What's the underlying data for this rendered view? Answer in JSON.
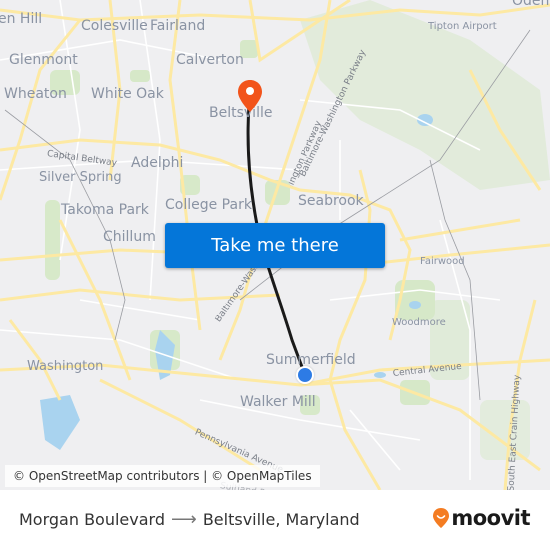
{
  "map": {
    "places": [
      {
        "id": "glen-hill",
        "label": "en Hill",
        "size": "l"
      },
      {
        "id": "colesville",
        "label": "Colesville",
        "size": "l"
      },
      {
        "id": "fairland",
        "label": "Fairland",
        "size": "l"
      },
      {
        "id": "glenmont",
        "label": "Glenmont",
        "size": "l"
      },
      {
        "id": "calverton",
        "label": "Calverton",
        "size": "l"
      },
      {
        "id": "wheaton",
        "label": "Wheaton",
        "size": "l"
      },
      {
        "id": "white-oak",
        "label": "White Oak",
        "size": "l"
      },
      {
        "id": "beltsville",
        "label": "Beltsville",
        "size": "l"
      },
      {
        "id": "adelphi",
        "label": "Adelphi",
        "size": "l"
      },
      {
        "id": "silver-spring",
        "label": "Silver Spring",
        "size": "m"
      },
      {
        "id": "takoma-park",
        "label": "Takoma Park",
        "size": "l"
      },
      {
        "id": "college-park",
        "label": "College Park",
        "size": "l"
      },
      {
        "id": "seabrook",
        "label": "Seabrook",
        "size": "l"
      },
      {
        "id": "chillum",
        "label": "Chillum",
        "size": "l"
      },
      {
        "id": "washington",
        "label": "Washington",
        "size": "m"
      },
      {
        "id": "summerfield",
        "label": "Summerfield",
        "size": "l"
      },
      {
        "id": "walker-mill",
        "label": "Walker Mill",
        "size": "l"
      },
      {
        "id": "woodmore",
        "label": "Woodmore",
        "size": "s"
      },
      {
        "id": "fairwood",
        "label": "Fairwood",
        "size": "s"
      },
      {
        "id": "tipton-airport",
        "label": "Tipton Airport",
        "size": "s"
      },
      {
        "id": "odenton",
        "label": "Oden",
        "size": "l"
      }
    ],
    "road_labels": [
      {
        "id": "capital-beltway",
        "label": "Capital Beltway"
      },
      {
        "id": "bw-parkway-north",
        "label": "Baltimore-Washington Parkway"
      },
      {
        "id": "bw-parkway-mid",
        "label": "Baltimore-Washington Parkway"
      },
      {
        "id": "bw-parkway-south",
        "label": "Baltimore-Washington Parkway"
      },
      {
        "id": "central-avenue",
        "label": "Central Avenue"
      },
      {
        "id": "pennsylvania-avenue",
        "label": "Pennsylvania Avenue"
      },
      {
        "id": "south-east-crain-highway",
        "label": "South East Crain Highway"
      },
      {
        "id": "suitland-parkway",
        "label": "Suitland Parkway"
      }
    ],
    "cta_label": "Take me there",
    "attribution": "© OpenStreetMap contributors | © OpenMapTiles",
    "colors": {
      "route": "#1a1a1a",
      "destination_pin": "#f2541b",
      "origin_dot": "#2d7be5",
      "button": "#0476d9"
    }
  },
  "footer": {
    "origin": "Morgan Boulevard",
    "arrow": "⟶",
    "destination": "Beltsville, Maryland",
    "brand": "moovit",
    "brand_color": "#f47c22"
  }
}
